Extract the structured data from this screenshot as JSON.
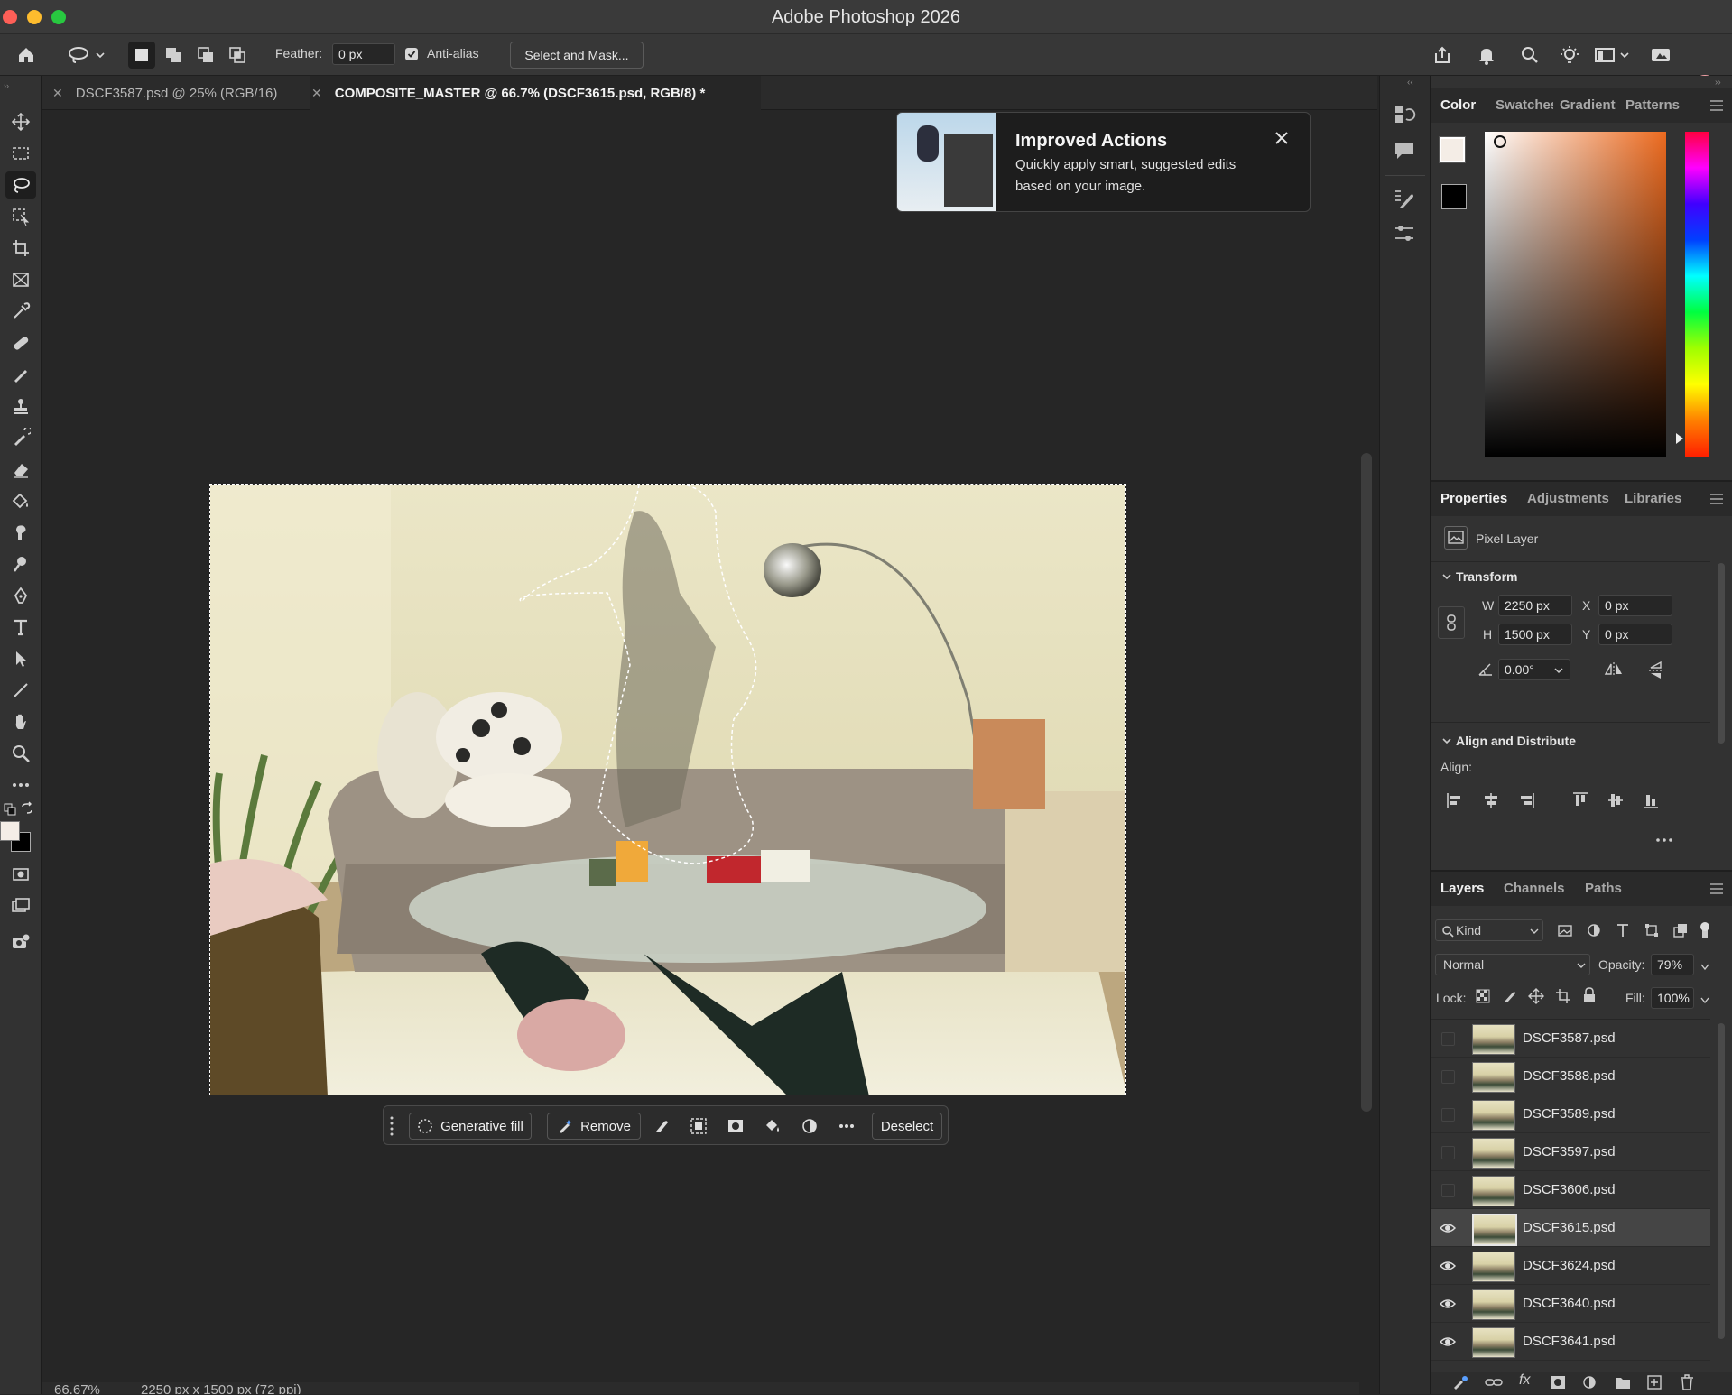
{
  "window": {
    "title": "Adobe Photoshop 2026"
  },
  "options": {
    "feather_label": "Feather:",
    "feather_value": "0 px",
    "antialias_label": "Anti-alias",
    "antialias_checked": true,
    "select_mask_label": "Select and Mask..."
  },
  "tabs": [
    {
      "label": "DSCF3587.psd @ 25% (RGB/16)",
      "active": false
    },
    {
      "label": "COMPOSITE_MASTER @ 66.7% (DSCF3615.psd, RGB/8) *",
      "active": true
    }
  ],
  "popup": {
    "title": "Improved Actions",
    "body_line1": "Quickly apply smart, suggested edits",
    "body_line2": "based on your image."
  },
  "context_bar": {
    "generative_fill": "Generative fill",
    "remove": "Remove",
    "deselect": "Deselect"
  },
  "status": {
    "zoom": "66.67%",
    "doc_info": "2250 px x 1500 px (72 ppi)"
  },
  "color_panel": {
    "tabs": [
      "Color",
      "Swatches",
      "Gradient",
      "Patterns"
    ],
    "active_tab": "Color",
    "hue_color": "#ec6a1f",
    "foreground": "#f4ede6",
    "background": "#000000"
  },
  "properties_panel": {
    "tabs": [
      "Properties",
      "Adjustments",
      "Libraries"
    ],
    "active_tab": "Properties",
    "layer_type": "Pixel Layer",
    "transform_title": "Transform",
    "w_label": "W",
    "w_value": "2250 px",
    "h_label": "H",
    "h_value": "1500 px",
    "x_label": "X",
    "x_value": "0 px",
    "y_label": "Y",
    "y_value": "0 px",
    "angle_value": "0.00°",
    "align_title": "Align and Distribute",
    "align_label": "Align:"
  },
  "layers_panel": {
    "tabs": [
      "Layers",
      "Channels",
      "Paths"
    ],
    "active_tab": "Layers",
    "kind_label": "Kind",
    "blend_mode": "Normal",
    "opacity_label": "Opacity:",
    "opacity_value": "79%",
    "lock_label": "Lock:",
    "fill_label": "Fill:",
    "fill_value": "100%",
    "layers": [
      {
        "name": "DSCF3587.psd",
        "visible": false,
        "selected": false
      },
      {
        "name": "DSCF3588.psd",
        "visible": false,
        "selected": false
      },
      {
        "name": "DSCF3589.psd",
        "visible": false,
        "selected": false
      },
      {
        "name": "DSCF3597.psd",
        "visible": false,
        "selected": false
      },
      {
        "name": "DSCF3606.psd",
        "visible": false,
        "selected": false
      },
      {
        "name": "DSCF3615.psd",
        "visible": true,
        "selected": true
      },
      {
        "name": "DSCF3624.psd",
        "visible": true,
        "selected": false
      },
      {
        "name": "DSCF3640.psd",
        "visible": true,
        "selected": false
      },
      {
        "name": "DSCF3641.psd",
        "visible": true,
        "selected": false
      }
    ]
  }
}
